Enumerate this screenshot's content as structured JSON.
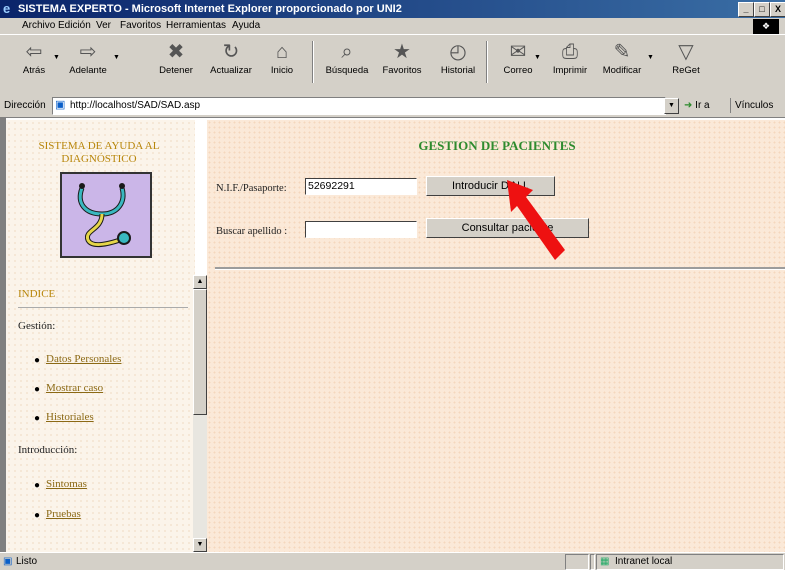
{
  "window": {
    "title": "SISTEMA EXPERTO - Microsoft Internet Explorer proporcionado por UNI2",
    "controls": [
      "_",
      "□",
      "X"
    ]
  },
  "menu": [
    "Archivo",
    "Edición",
    "Ver",
    "Favoritos",
    "Herramientas",
    "Ayuda"
  ],
  "toolbar": [
    {
      "label": "Atrás",
      "icon": "back-arrow-icon",
      "glyph": "⇦"
    },
    {
      "label": "Adelante",
      "icon": "forward-arrow-icon",
      "glyph": "⇨"
    },
    {
      "label": "Detener",
      "icon": "stop-icon",
      "glyph": "✖"
    },
    {
      "label": "Actualizar",
      "icon": "refresh-icon",
      "glyph": "↻"
    },
    {
      "label": "Inicio",
      "icon": "home-icon",
      "glyph": "⌂"
    },
    {
      "label": "Búsqueda",
      "icon": "search-icon",
      "glyph": "⌕"
    },
    {
      "label": "Favoritos",
      "icon": "favorites-icon",
      "glyph": "★"
    },
    {
      "label": "Historial",
      "icon": "history-icon",
      "glyph": "◴"
    },
    {
      "label": "Correo",
      "icon": "mail-icon",
      "glyph": "✉"
    },
    {
      "label": "Imprimir",
      "icon": "print-icon",
      "glyph": "⎙"
    },
    {
      "label": "Modificar",
      "icon": "edit-icon",
      "glyph": "✎"
    },
    {
      "label": "ReGet",
      "icon": "reget-icon",
      "glyph": "▽"
    }
  ],
  "address": {
    "label": "Dirección",
    "url": "http://localhost/SAD/SAD.asp",
    "go_label": "Ir a",
    "links_label": "Vínculos"
  },
  "sidebar": {
    "system_title": "SISTEMA DE AYUDA AL DIAGNÓSTICO",
    "index_title": "INDICE",
    "sections": [
      {
        "label": "Gestión:",
        "items": [
          "Datos Personales",
          "Mostrar caso",
          "Historiales"
        ]
      },
      {
        "label": "Introducción:",
        "items": [
          "Sintomas",
          "Pruebas"
        ]
      }
    ]
  },
  "main": {
    "heading": "GESTION DE PACIENTES",
    "nif_label": "N.I.F./Pasaporte:",
    "nif_value": "52692291",
    "introducir_button": "Introducir D.N.I.",
    "surname_label": "Buscar apellido :",
    "surname_value": "",
    "consultar_button": "Consultar paciente"
  },
  "status": {
    "text": "Listo",
    "zone": "Intranet local"
  },
  "colors": {
    "titlebar_start": "#0a246a",
    "heading_green": "#2e8b2e",
    "sidebar_gold": "#b8860b",
    "annotation_red": "#ee1111"
  }
}
